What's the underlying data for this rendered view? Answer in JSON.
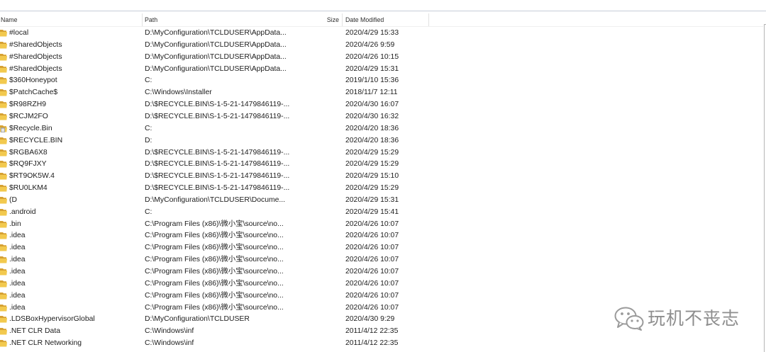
{
  "columns": [
    {
      "label": "Name"
    },
    {
      "label": "Path"
    },
    {
      "label": "Size"
    },
    {
      "label": "Date Modified"
    }
  ],
  "rows": [
    {
      "icon": "folder-icon",
      "name": "#local",
      "path": "D:\\MyConfiguration\\TCLDUSER\\AppData...",
      "modified": "2020/4/29 15:33"
    },
    {
      "icon": "folder-icon",
      "name": "#SharedObjects",
      "path": "D:\\MyConfiguration\\TCLDUSER\\AppData...",
      "modified": "2020/4/26 9:59"
    },
    {
      "icon": "folder-icon",
      "name": "#SharedObjects",
      "path": "D:\\MyConfiguration\\TCLDUSER\\AppData...",
      "modified": "2020/4/26 10:15"
    },
    {
      "icon": "folder-icon",
      "name": "#SharedObjects",
      "path": "D:\\MyConfiguration\\TCLDUSER\\AppData...",
      "modified": "2020/4/29 15:31"
    },
    {
      "icon": "folder-icon",
      "name": "$360Honeypot",
      "path": "C:",
      "modified": "2019/1/10 15:36"
    },
    {
      "icon": "folder-icon",
      "name": "$PatchCache$",
      "path": "C:\\Windows\\Installer",
      "modified": "2018/11/7 12:11"
    },
    {
      "icon": "folder-icon",
      "name": "$R98RZH9",
      "path": "D:\\$RECYCLE.BIN\\S-1-5-21-1479846119-...",
      "modified": "2020/4/30 16:07"
    },
    {
      "icon": "folder-icon",
      "name": "$RCJM2FO",
      "path": "D:\\$RECYCLE.BIN\\S-1-5-21-1479846119-...",
      "modified": "2020/4/30 16:32"
    },
    {
      "icon": "recycle-bin-icon",
      "name": "$Recycle.Bin",
      "path": "C:",
      "modified": "2020/4/20 18:36"
    },
    {
      "icon": "folder-icon",
      "name": "$RECYCLE.BIN",
      "path": "D:",
      "modified": "2020/4/20 18:36"
    },
    {
      "icon": "folder-icon",
      "name": "$RGBA6X8",
      "path": "D:\\$RECYCLE.BIN\\S-1-5-21-1479846119-...",
      "modified": "2020/4/29 15:29"
    },
    {
      "icon": "folder-icon",
      "name": "$RQ9FJXY",
      "path": "D:\\$RECYCLE.BIN\\S-1-5-21-1479846119-...",
      "modified": "2020/4/29 15:29"
    },
    {
      "icon": "folder-icon",
      "name": "$RT9OK5W.4",
      "path": "D:\\$RECYCLE.BIN\\S-1-5-21-1479846119-...",
      "modified": "2020/4/29 15:10"
    },
    {
      "icon": "folder-icon",
      "name": "$RU0LKM4",
      "path": "D:\\$RECYCLE.BIN\\S-1-5-21-1479846119-...",
      "modified": "2020/4/29 15:29"
    },
    {
      "icon": "folder-icon",
      "name": "(D",
      "path": "D:\\MyConfiguration\\TCLDUSER\\Docume...",
      "modified": "2020/4/29 15:31"
    },
    {
      "icon": "folder-icon",
      "name": ".android",
      "path": "C:",
      "modified": "2020/4/29 15:41"
    },
    {
      "icon": "folder-icon",
      "name": ".bin",
      "path": "C:\\Program Files (x86)\\微小宝\\source\\no...",
      "modified": "2020/4/26 10:07"
    },
    {
      "icon": "folder-icon",
      "name": ".idea",
      "path": "C:\\Program Files (x86)\\微小宝\\source\\no...",
      "modified": "2020/4/26 10:07"
    },
    {
      "icon": "folder-icon",
      "name": ".idea",
      "path": "C:\\Program Files (x86)\\微小宝\\source\\no...",
      "modified": "2020/4/26 10:07"
    },
    {
      "icon": "folder-icon",
      "name": ".idea",
      "path": "C:\\Program Files (x86)\\微小宝\\source\\no...",
      "modified": "2020/4/26 10:07"
    },
    {
      "icon": "folder-icon",
      "name": ".idea",
      "path": "C:\\Program Files (x86)\\微小宝\\source\\no...",
      "modified": "2020/4/26 10:07"
    },
    {
      "icon": "folder-icon",
      "name": ".idea",
      "path": "C:\\Program Files (x86)\\微小宝\\source\\no...",
      "modified": "2020/4/26 10:07"
    },
    {
      "icon": "folder-icon",
      "name": ".idea",
      "path": "C:\\Program Files (x86)\\微小宝\\source\\no...",
      "modified": "2020/4/26 10:07"
    },
    {
      "icon": "folder-icon",
      "name": ".idea",
      "path": "C:\\Program Files (x86)\\微小宝\\source\\no...",
      "modified": "2020/4/26 10:07"
    },
    {
      "icon": "folder-icon",
      "name": ".LDSBoxHypervisorGlobal",
      "path": "D:\\MyConfiguration\\TCLDUSER",
      "modified": "2020/4/30 9:29"
    },
    {
      "icon": "folder-icon",
      "name": ".NET CLR Data",
      "path": "C:\\Windows\\inf",
      "modified": "2011/4/12 22:35"
    },
    {
      "icon": "folder-icon",
      "name": ".NET CLR Networking",
      "path": "C:\\Windows\\inf",
      "modified": "2011/4/12 22:35"
    }
  ],
  "watermark": {
    "icon": "wechat-icon",
    "text": "玩机不丧志"
  },
  "colors": {
    "folder_light": "#f2c94e",
    "folder_dark": "#d6a132",
    "bin_gray": "#9a9a9a",
    "watermark": "#9a9a9a"
  }
}
